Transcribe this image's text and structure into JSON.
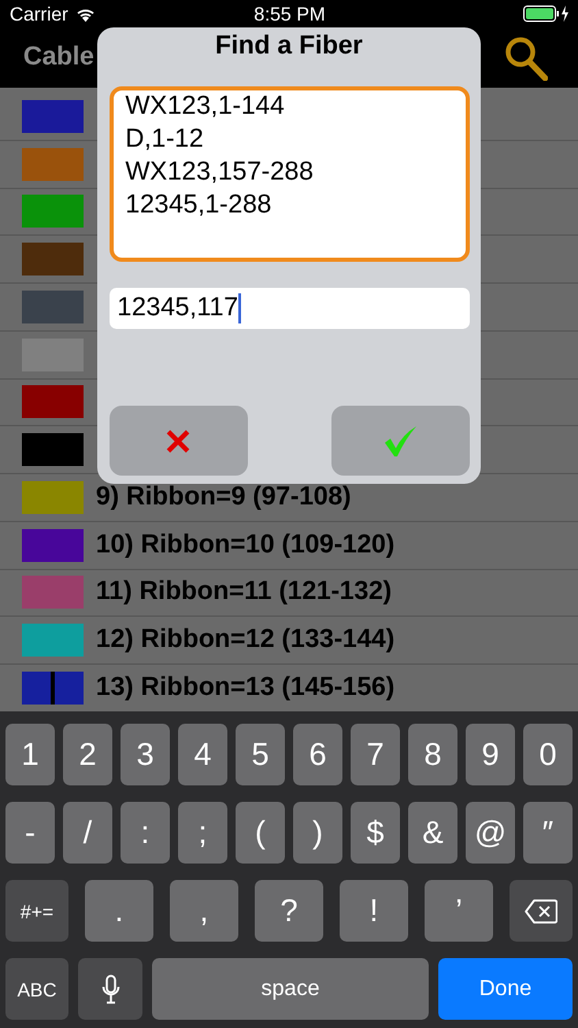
{
  "status_bar": {
    "carrier": "Carrier",
    "time": "8:55 PM"
  },
  "nav_bar": {
    "title": "Cable"
  },
  "ribbons": [
    {
      "kind": "solid",
      "color": "#1a1a9a"
    },
    {
      "kind": "solid",
      "color": "#9a520c"
    },
    {
      "kind": "solid",
      "color": "#0a920a"
    },
    {
      "kind": "solid",
      "color": "#4e2c0c"
    },
    {
      "kind": "solid",
      "color": "#3a424c"
    },
    {
      "kind": "solid",
      "color": "#808080"
    },
    {
      "kind": "solid",
      "color": "#880000"
    },
    {
      "kind": "solid",
      "color": "#000000"
    },
    {
      "kind": "solid",
      "color": "#8a8600",
      "label": "9) Ribbon=9 (97-108)"
    },
    {
      "kind": "solid",
      "color": "#48069a",
      "label": "10) Ribbon=10 (109-120)"
    },
    {
      "kind": "solid",
      "color": "#9a3e6a",
      "label": "11) Ribbon=11 (121-132)"
    },
    {
      "kind": "solid",
      "color": "#0e9e9e",
      "label": "12) Ribbon=12 (133-144)"
    },
    {
      "kind": "striped",
      "color": "#16209e",
      "label": "13) Ribbon=13 (145-156)"
    }
  ],
  "dialog": {
    "title": "Find a Fiber",
    "history": [
      "WX123,1-144",
      "D,1-12",
      "WX123,157-288",
      "12345,1-288"
    ],
    "search": {
      "value": "12345,117"
    },
    "buttons": [
      {
        "kind": "cancel"
      },
      {
        "kind": "confirm"
      }
    ]
  },
  "keyboard": {
    "number_keys": [
      {
        "kind": "key",
        "label": "1"
      },
      {
        "kind": "key",
        "label": "2"
      },
      {
        "kind": "key",
        "label": "3"
      },
      {
        "kind": "key",
        "label": "4"
      },
      {
        "kind": "key",
        "label": "5"
      },
      {
        "kind": "key",
        "label": "6"
      },
      {
        "kind": "key",
        "label": "7"
      },
      {
        "kind": "key",
        "label": "8"
      },
      {
        "kind": "key",
        "label": "9"
      },
      {
        "kind": "key",
        "label": "0"
      }
    ],
    "symbol_keys": [
      {
        "kind": "key",
        "label": "-"
      },
      {
        "kind": "key",
        "label": "/"
      },
      {
        "kind": "key",
        "label": ":"
      },
      {
        "kind": "key",
        "label": ";"
      },
      {
        "kind": "key",
        "label": "("
      },
      {
        "kind": "key",
        "label": ")"
      },
      {
        "kind": "key",
        "label": "$"
      },
      {
        "kind": "key",
        "label": "&"
      },
      {
        "kind": "key",
        "label": "@"
      },
      {
        "kind": "key",
        "label": "″"
      }
    ],
    "punctuation_keys": [
      {
        "kind": "mode",
        "label": "#+="
      },
      {
        "kind": "wide",
        "label": "."
      },
      {
        "kind": "wide",
        "label": ","
      },
      {
        "kind": "wide",
        "label": "?"
      },
      {
        "kind": "wide",
        "label": "!"
      },
      {
        "kind": "wide",
        "label": "’"
      },
      {
        "kind": "delete"
      }
    ],
    "bottom_keys": [
      {
        "kind": "mode",
        "label": "ABC"
      },
      {
        "kind": "mic"
      },
      {
        "kind": "space",
        "label": "space"
      },
      {
        "kind": "done",
        "label": "Done"
      }
    ]
  }
}
